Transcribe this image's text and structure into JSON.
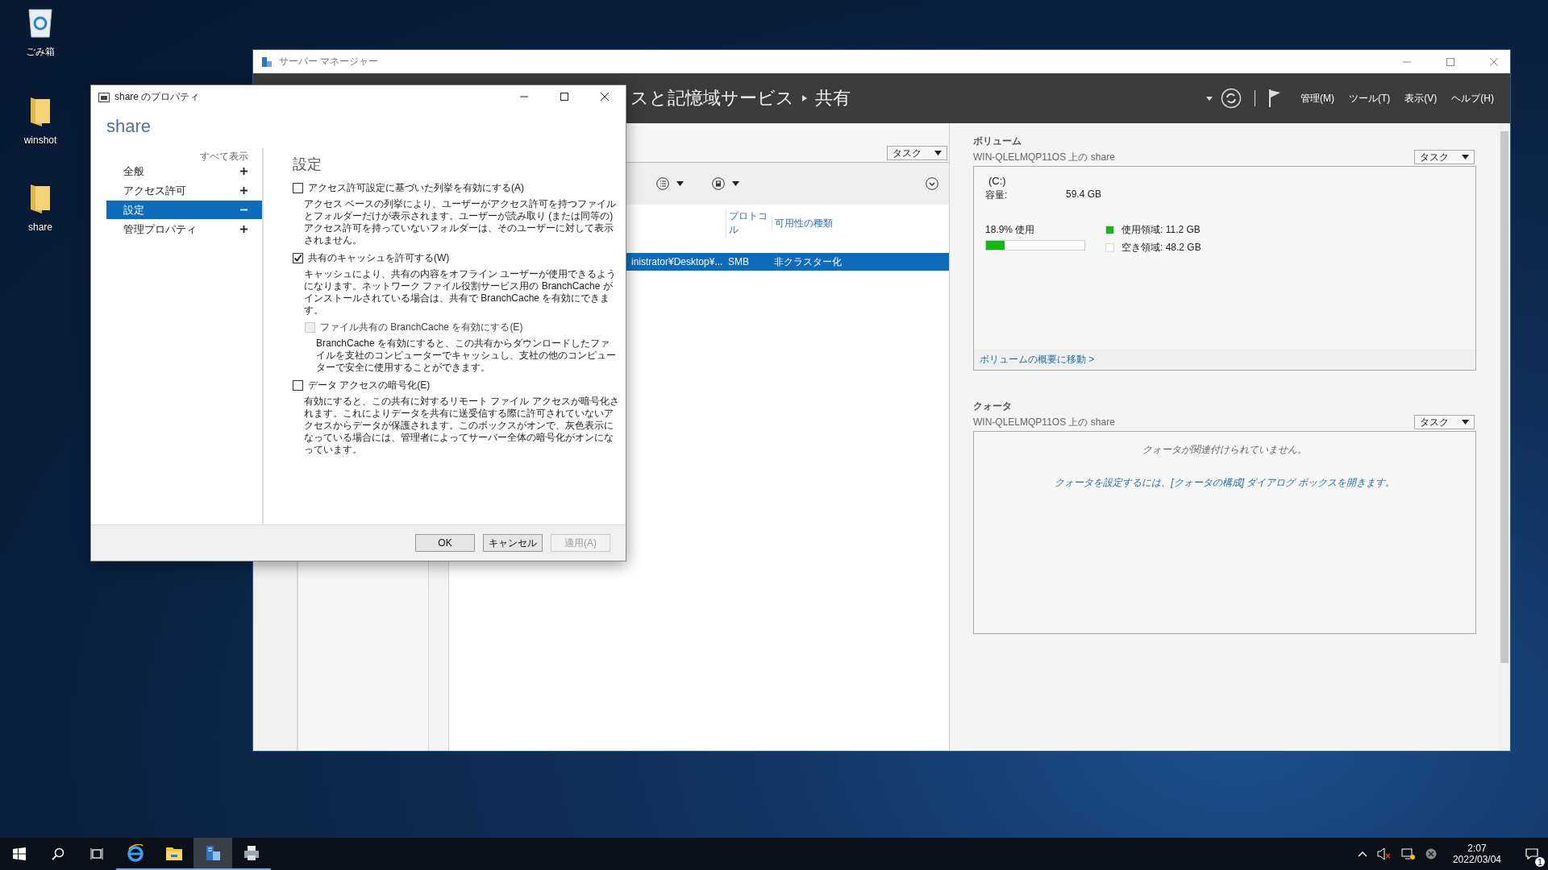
{
  "desktop_icons": [
    {
      "label": "ごみ箱",
      "kind": "bin"
    },
    {
      "label": "winshot",
      "kind": "folder"
    },
    {
      "label": "share",
      "kind": "folder"
    }
  ],
  "server_manager": {
    "title": "サーバー マネージャー",
    "breadcrumb": [
      "スと記憶域サービス",
      "共有"
    ],
    "menus": [
      "管理(M)",
      "ツール(T)",
      "表示(V)",
      "ヘルプ(H)"
    ],
    "shares": {
      "task_button": "タスク",
      "columns": [
        "プロトコル",
        "可用性の種類"
      ],
      "rows": [
        {
          "path": "inistrator¥Desktop¥...",
          "protocol": "SMB",
          "availability": "非クラスター化",
          "selected": true
        }
      ]
    },
    "volume": {
      "heading": "ボリューム",
      "subtitle": "WIN-QLELMQP11OS 上の share",
      "task_button": "タスク",
      "drive": "(C:)",
      "capacity_label": "容量:",
      "capacity": "59.4 GB",
      "usage": "18.9% 使用",
      "level": 0.189,
      "legend": [
        {
          "label": "使用領域: 11.2 GB",
          "color": "#13b913"
        },
        {
          "label": "空き領域: 48.2 GB",
          "color": "#ffffff"
        }
      ],
      "link": "ボリュームの概要に移動 >"
    },
    "quota": {
      "heading": "クォータ",
      "subtitle": "WIN-QLELMQP11OS 上の share",
      "task_button": "タスク",
      "empty": "クォータが関連付けられていません。",
      "hint": "クォータを設定するには、[クォータの構成] ダイアログ ボックスを開きます。"
    }
  },
  "dialog": {
    "title": "share のプロパティ",
    "heading": "share",
    "show_all": "すべて表示",
    "nav": [
      {
        "label": "全般",
        "selected": false,
        "expanded": false
      },
      {
        "label": "アクセス許可",
        "selected": false,
        "expanded": false
      },
      {
        "label": "設定",
        "selected": true,
        "expanded": true
      },
      {
        "label": "管理プロパティ",
        "selected": false,
        "expanded": false
      }
    ],
    "section": "設定",
    "options": [
      {
        "label": "アクセス許可設定に基づいた列挙を有効にする(A)",
        "checked": false,
        "disabled": false,
        "description": "アクセス ベースの列挙により、ユーザーがアクセス許可を持つファイルとフォルダーだけが表示されます。ユーザーが読み取り (または同等の) アクセス許可を持っていないフォルダーは、そのユーザーに対して表示されません。"
      },
      {
        "label": "共有のキャッシュを許可する(W)",
        "checked": true,
        "disabled": false,
        "description": "キャッシュにより、共有の内容をオフライン ユーザーが使用できるようになります。ネットワーク ファイル役割サービス用の BranchCache がインストールされている場合は、共有で BranchCache を有効にできます。",
        "children": [
          {
            "label": "ファイル共有の BranchCache を有効にする(E)",
            "checked": false,
            "disabled": true,
            "description": "BranchCache を有効にすると、この共有からダウンロードしたファイルを支社のコンピューターでキャッシュし、支社の他のコンピューターで安全に使用することができます。"
          }
        ]
      },
      {
        "label": "データ アクセスの暗号化(E)",
        "checked": false,
        "disabled": false,
        "description": "有効にすると、この共有に対するリモート ファイル アクセスが暗号化されます。これによりデータを共有に送受信する際に許可されていないアクセスからデータが保護されます。このボックスがオンで、灰色表示になっている場合には、管理者によってサーバー全体の暗号化がオンになっています。"
      }
    ],
    "buttons": [
      {
        "label": "OK",
        "disabled": false
      },
      {
        "label": "キャンセル",
        "disabled": false
      },
      {
        "label": "適用(A)",
        "disabled": true
      }
    ]
  },
  "taskbar": {
    "apps": [
      {
        "kind": "browser",
        "active": false
      },
      {
        "kind": "explorer",
        "active": false
      },
      {
        "kind": "server-manager",
        "active": true
      },
      {
        "kind": "printer",
        "active": false
      }
    ],
    "time": "2:07",
    "date": "2022/03/04",
    "notification_badge": "1"
  }
}
